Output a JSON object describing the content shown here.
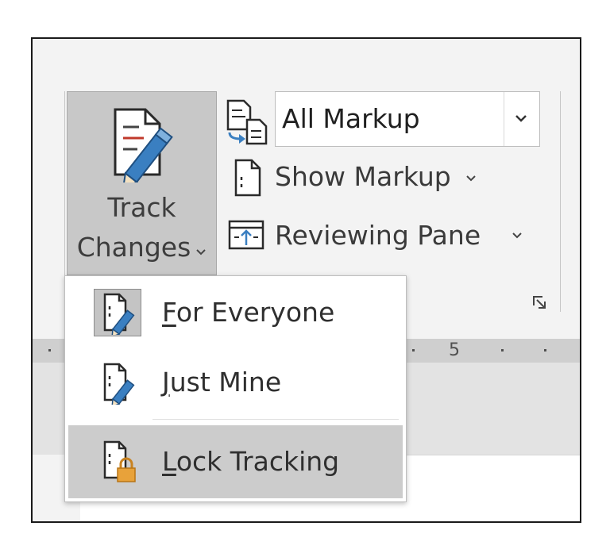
{
  "ribbon": {
    "track_changes": {
      "label_line1": "Track",
      "label_line2": "Changes",
      "icon": "track-changes-pencil-icon"
    },
    "display_for_review": {
      "icon": "display-for-review-icon",
      "selected": "All Markup"
    },
    "show_markup": {
      "label": "Show Markup",
      "icon": "show-markup-icon"
    },
    "reviewing_pane": {
      "label": "Reviewing Pane",
      "icon": "reviewing-pane-icon"
    },
    "dialog_launcher_icon": "dialog-launcher-icon"
  },
  "ruler": {
    "label": "5"
  },
  "track_menu": {
    "items": [
      {
        "prefix": "",
        "mnemonic": "F",
        "rest": "or Everyone",
        "icon": "for-everyone-icon",
        "checked": true
      },
      {
        "prefix": "",
        "mnemonic": "J",
        "rest": "ust Mine",
        "icon": "just-mine-icon",
        "checked": false
      },
      {
        "prefix": "",
        "mnemonic": "L",
        "rest": "ock Tracking",
        "icon": "lock-tracking-icon",
        "hovered": true
      }
    ]
  },
  "colors": {
    "ribbon_bg": "#f3f3f3",
    "pressed_button": "#c8c8c8",
    "pencil_blue": "#3a7fc1",
    "lock_orange": "#e8a23a",
    "menu_hover": "#cccccc"
  }
}
